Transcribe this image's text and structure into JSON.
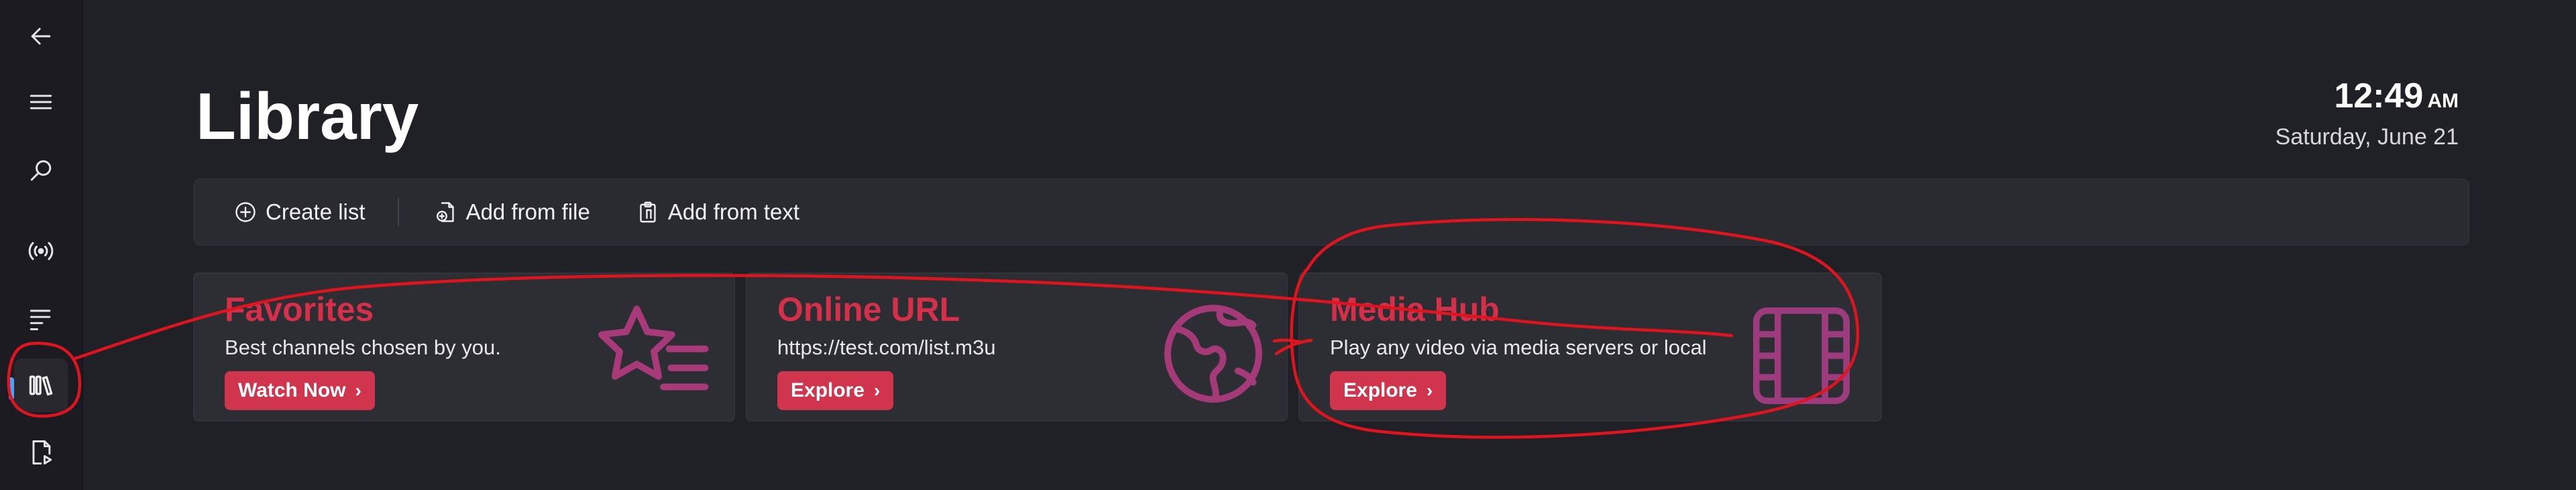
{
  "sidebar": {
    "items": [
      {
        "name": "back",
        "icon": "back-arrow-icon"
      },
      {
        "name": "menu",
        "icon": "hamburger-icon"
      },
      {
        "name": "search",
        "icon": "search-icon"
      },
      {
        "name": "live",
        "icon": "broadcast-icon"
      },
      {
        "name": "list",
        "icon": "list-icon"
      },
      {
        "name": "library",
        "icon": "library-icon",
        "active": true
      },
      {
        "name": "media",
        "icon": "media-file-icon"
      }
    ]
  },
  "header": {
    "title": "Library",
    "time": "12:49",
    "ampm": "AM",
    "date": "Saturday, June 21"
  },
  "toolbar": {
    "create_list": "Create list",
    "add_from_file": "Add from file",
    "add_from_text": "Add from text"
  },
  "cards": [
    {
      "title": "Favorites",
      "subtitle": "Best channels chosen by you.",
      "button": "Watch Now",
      "icon": "star-list-icon"
    },
    {
      "title": "Online URL",
      "subtitle": "https://test.com/list.m3u",
      "button": "Explore",
      "icon": "globe-icon"
    },
    {
      "title": "Media Hub",
      "subtitle": "Play any video via media servers or local",
      "button": "Explore",
      "icon": "film-icon"
    }
  ],
  "colors": {
    "accent": "#d1344d",
    "nav_indicator": "#4aa3f2",
    "annotation": "#e0141e"
  }
}
